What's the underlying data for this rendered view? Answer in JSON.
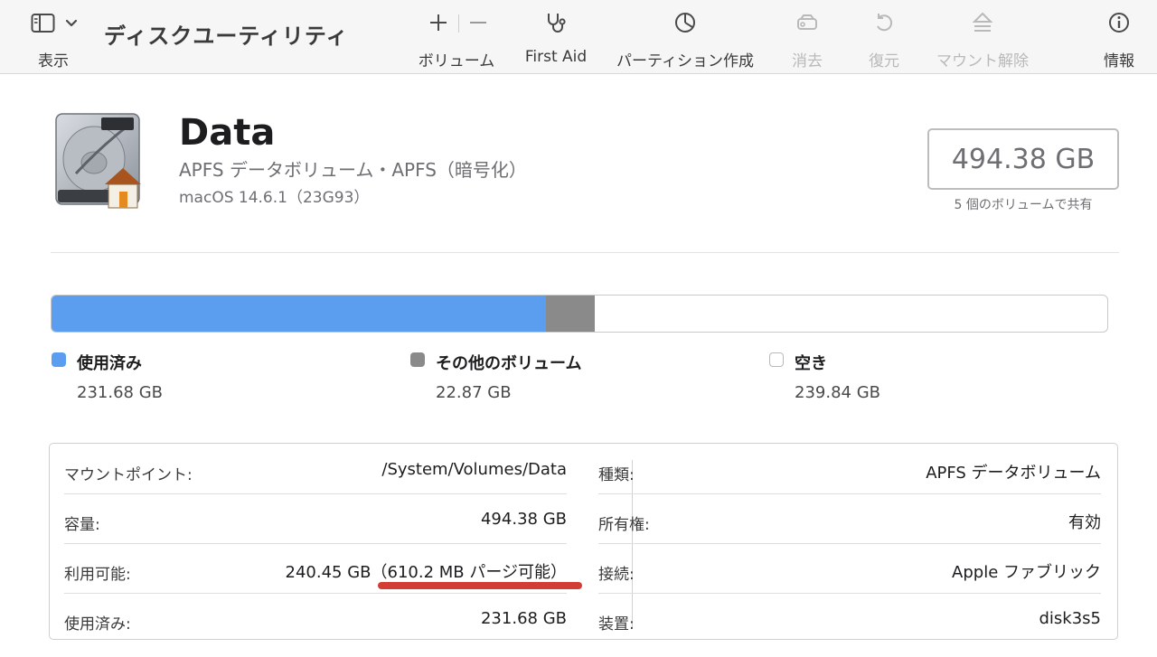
{
  "toolbar": {
    "view_label": "表示",
    "app_title": "ディスクユーティリティ",
    "volume_label": "ボリューム",
    "first_aid_label": "First Aid",
    "partition_label": "パーティション作成",
    "erase_label": "消去",
    "restore_label": "復元",
    "unmount_label": "マウント解除",
    "info_label": "情報"
  },
  "volume": {
    "name": "Data",
    "subtitle": "APFS データボリューム・APFS（暗号化）",
    "os": "macOS 14.6.1（23G93）",
    "capacity": "494.38 GB",
    "shared_note": "5 個のボリュームで共有"
  },
  "usage": {
    "used_fraction": 0.4686,
    "other_fraction": 0.0463,
    "legend": [
      {
        "label": "使用済み",
        "value": "231.68 GB",
        "color": "#5b9ef0"
      },
      {
        "label": "その他のボリューム",
        "value": "22.87 GB",
        "color": "#8a8a8a"
      },
      {
        "label": "空き",
        "value": "239.84 GB",
        "color": "#ffffff"
      }
    ]
  },
  "info": {
    "left": [
      {
        "key": "マウントポイント:",
        "value": "/System/Volumes/Data"
      },
      {
        "key": "容量:",
        "value": "494.38 GB"
      },
      {
        "key": "利用可能:",
        "value": "240.45 GB（610.2 MB パージ可能）"
      },
      {
        "key": "使用済み:",
        "value": "231.68 GB"
      }
    ],
    "right": [
      {
        "key": "種類:",
        "value": "APFS データボリューム"
      },
      {
        "key": "所有権:",
        "value": "有効"
      },
      {
        "key": "接続:",
        "value": "Apple ファブリック"
      },
      {
        "key": "装置:",
        "value": "disk3s5"
      }
    ]
  },
  "colors": {
    "accent_blue": "#5b9ef0",
    "other_gray": "#8a8a8a",
    "highlight_red": "#d23d34"
  }
}
